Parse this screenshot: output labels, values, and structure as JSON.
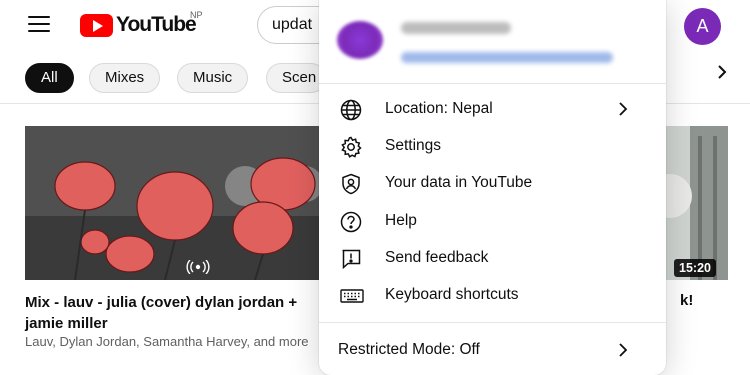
{
  "header": {
    "logo_text": "YouTube",
    "country_code": "NP",
    "search_value": "updat",
    "avatar_letter": "A"
  },
  "chips": [
    {
      "label": "All",
      "active": true
    },
    {
      "label": "Mixes",
      "active": false
    },
    {
      "label": "Music",
      "active": false
    },
    {
      "label": "Scen",
      "active": false
    }
  ],
  "videos": [
    {
      "title": "Mix - lauv - julia (cover) dylan jordan + jamie miller",
      "meta": "Lauv, Dylan Jordan, Samantha Harvey, and more"
    },
    {
      "title": "k!",
      "duration": "15:20"
    }
  ],
  "menu": {
    "items": [
      {
        "label": "Location: Nepal",
        "icon": "globe-icon",
        "has_arrow": true
      },
      {
        "label": "Settings",
        "icon": "gear-icon",
        "has_arrow": false
      },
      {
        "label": "Your data in YouTube",
        "icon": "shield-user-icon",
        "has_arrow": false
      },
      {
        "label": "Help",
        "icon": "help-icon",
        "has_arrow": false
      },
      {
        "label": "Send feedback",
        "icon": "feedback-icon",
        "has_arrow": false
      },
      {
        "label": "Keyboard shortcuts",
        "icon": "keyboard-icon",
        "has_arrow": false
      }
    ],
    "restricted_mode": "Restricted Mode: Off"
  },
  "colors": {
    "brand_red": "#ff0000",
    "avatar_purple": "#7b2ab8",
    "chip_active": "#0f0f0f"
  }
}
